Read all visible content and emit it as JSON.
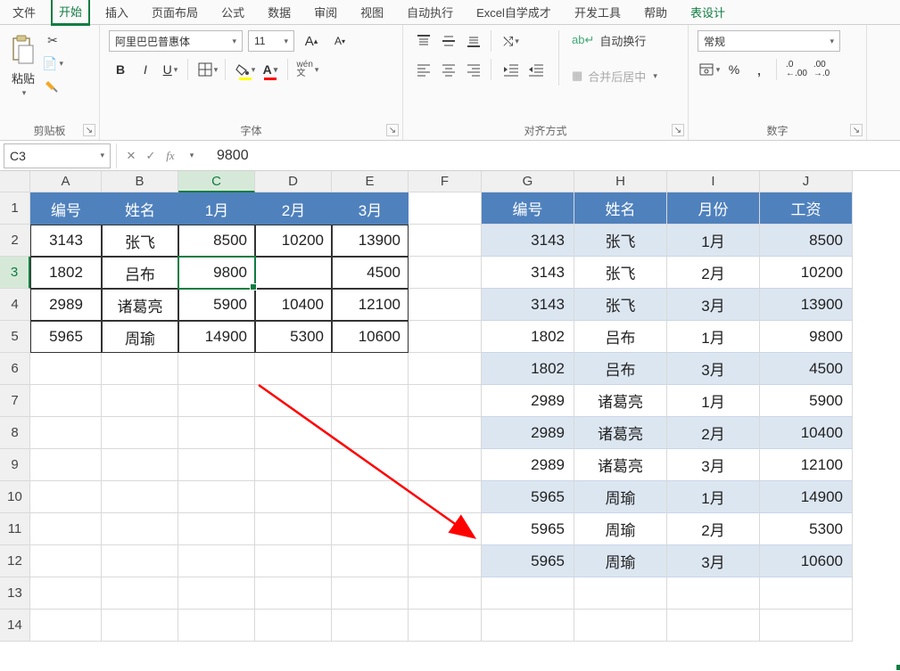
{
  "tabs": [
    "文件",
    "开始",
    "插入",
    "页面布局",
    "公式",
    "数据",
    "审阅",
    "视图",
    "自动执行",
    "Excel自学成才",
    "开发工具",
    "帮助",
    "表设计"
  ],
  "active_tab": 1,
  "clipboard": {
    "label": "剪贴板",
    "paste": "粘贴"
  },
  "font": {
    "label": "字体",
    "name": "阿里巴巴普惠体",
    "size": "11",
    "wen": "wén\n文"
  },
  "alignment": {
    "label": "对齐方式",
    "wrap": "自动换行",
    "merge": "合并后居中"
  },
  "number": {
    "label": "数字",
    "format": "常规"
  },
  "cell_ref": "C3",
  "formula_value": "9800",
  "columns": [
    "A",
    "B",
    "C",
    "D",
    "E",
    "F",
    "G",
    "H",
    "I",
    "J"
  ],
  "row_count": 14,
  "selected_col": 2,
  "selected_row": 3,
  "table1": {
    "headers": [
      "编号",
      "姓名",
      "1月",
      "2月",
      "3月"
    ],
    "rows": [
      [
        "3143",
        "张飞",
        "8500",
        "10200",
        "13900"
      ],
      [
        "1802",
        "吕布",
        "9800",
        "",
        "4500"
      ],
      [
        "2989",
        "诸葛亮",
        "5900",
        "10400",
        "12100"
      ],
      [
        "5965",
        "周瑜",
        "14900",
        "5300",
        "10600"
      ]
    ]
  },
  "table2": {
    "headers": [
      "编号",
      "姓名",
      "月份",
      "工资"
    ],
    "rows": [
      [
        "3143",
        "张飞",
        "1月",
        "8500"
      ],
      [
        "3143",
        "张飞",
        "2月",
        "10200"
      ],
      [
        "3143",
        "张飞",
        "3月",
        "13900"
      ],
      [
        "1802",
        "吕布",
        "1月",
        "9800"
      ],
      [
        "1802",
        "吕布",
        "3月",
        "4500"
      ],
      [
        "2989",
        "诸葛亮",
        "1月",
        "5900"
      ],
      [
        "2989",
        "诸葛亮",
        "2月",
        "10400"
      ],
      [
        "2989",
        "诸葛亮",
        "3月",
        "12100"
      ],
      [
        "5965",
        "周瑜",
        "1月",
        "14900"
      ],
      [
        "5965",
        "周瑜",
        "2月",
        "5300"
      ],
      [
        "5965",
        "周瑜",
        "3月",
        "10600"
      ]
    ]
  }
}
